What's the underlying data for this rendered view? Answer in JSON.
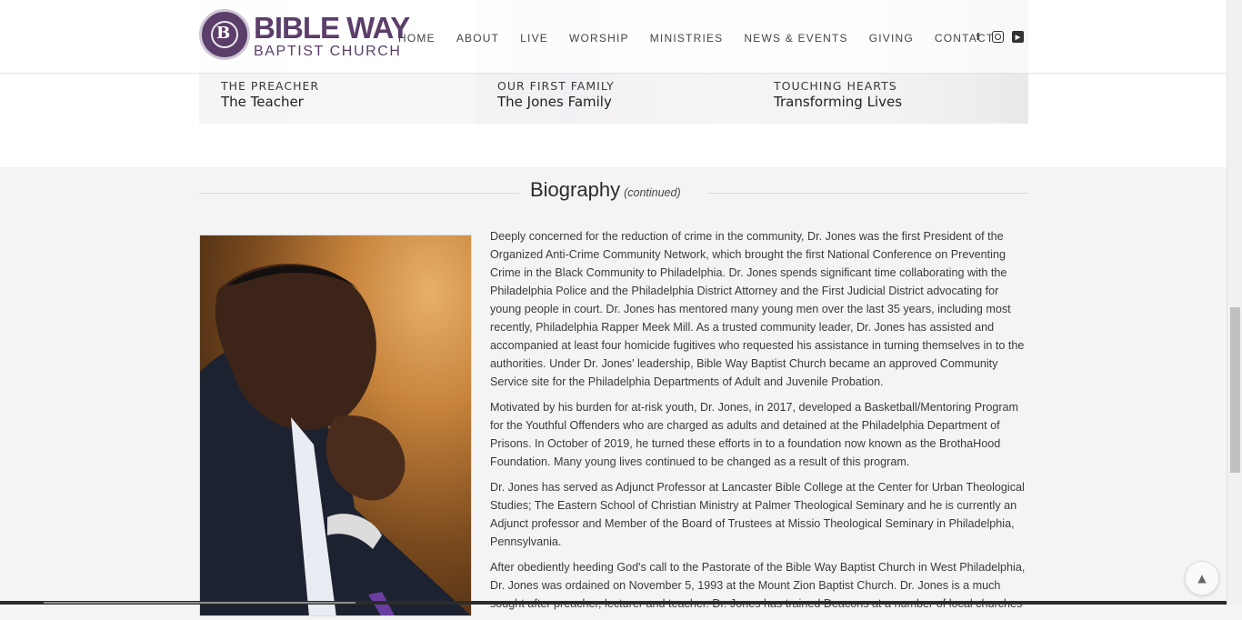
{
  "brand": {
    "line1": "BIBLE WAY",
    "line2": "BAPTIST CHURCH",
    "mark_letter": "B",
    "purple": "#5b3e69"
  },
  "nav": [
    "HOME",
    "ABOUT",
    "LIVE",
    "WORSHIP",
    "MINISTRIES",
    "NEWS & EVENTS",
    "GIVING",
    "CONTACT"
  ],
  "social": [
    "facebook-icon",
    "instagram-icon",
    "youtube-icon"
  ],
  "tiles": [
    {
      "kicker": "THE PREACHER",
      "title": "The Teacher"
    },
    {
      "kicker": "OUR FIRST FAMILY",
      "title": "The Jones Family"
    },
    {
      "kicker": "TOUCHING HEARTS",
      "title": "Transforming Lives"
    }
  ],
  "bio": {
    "heading": "Biography",
    "heading_note": "(continued)",
    "paragraphs": [
      "Deeply concerned for the reduction of crime in the community, Dr. Jones was the first President of the Organized Anti-Crime Community Network, which brought the first National Conference on Preventing Crime in the Black Community to Philadelphia.  Dr. Jones spends significant time collaborating with the Philadelphia Police and the Philadelphia District Attorney and the First Judicial District advocating for young people in court. Dr. Jones has mentored many young men over the last 35 years, including most recently, Philadelphia Rapper Meek Mill.  As a trusted community leader, Dr. Jones has assisted and accompanied at least four homicide fugitives who requested his assistance in turning themselves in to the authorities.  Under Dr. Jones' leadership, Bible Way Baptist Church became an approved Community Service site for the Philadelphia Departments of Adult and Juvenile Probation.",
      "Motivated by his burden for at-risk youth, Dr. Jones, in 2017, developed a Basketball/Mentoring Program for the Youthful Offenders who are charged as adults and detained at the Philadelphia Department of Prisons. In October of 2019, he turned these efforts in to a foundation now known as the BrothaHood Foundation. Many young lives continued to be changed as a result of this program.",
      "Dr. Jones has served as Adjunct Professor at Lancaster Bible College at the Center for Urban Theological Studies; The Eastern School of Christian Ministry at Palmer Theological Seminary and he is currently an Adjunct professor and Member of the Board of Trustees at Missio Theological Seminary in Philadelphia, Pennsylvania.",
      "After obediently heeding God's call to the Pastorate of the Bible Way Baptist Church in West Philadelphia, Dr. Jones was ordained on November 5, 1993 at the Mount Zion Baptist Church.  Dr. Jones is a much sought after preacher, lecturer and teacher.  Dr. Jones has trained Deacons at a number of local churches"
    ]
  },
  "back_to_top_icon": "triangle-up-icon"
}
